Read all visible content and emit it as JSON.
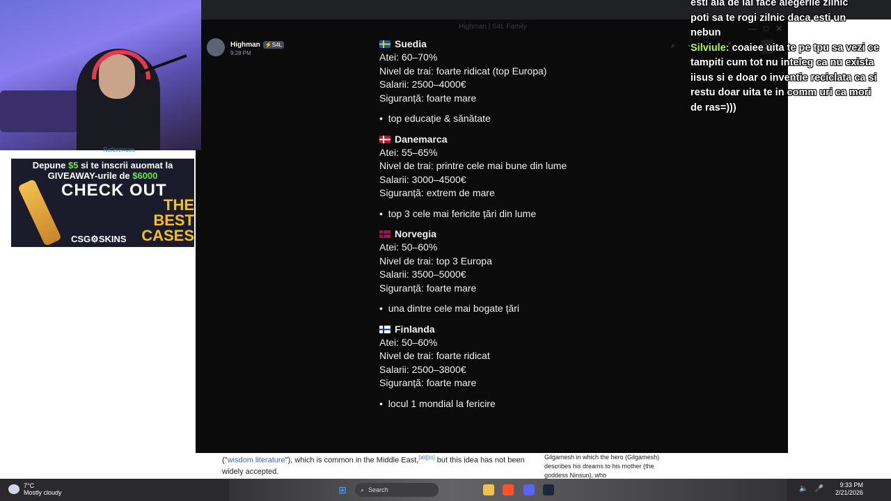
{
  "window_title": "Highman | S4L Family",
  "post": {
    "username": "Highman",
    "badge": "⚡S4L",
    "time": "9:28 PM"
  },
  "countries": [
    {
      "name": "Suedia",
      "flag_colors": [
        "#0a5bb4",
        "#f6cd00"
      ],
      "atei": "Atei: 60–70%",
      "nivel": "Nivel de trai: foarte ridicat (top Europa)",
      "salarii": "Salarii: 2500–4000€",
      "siguranta": "Siguranță: foarte mare",
      "note": "top educație & sănătate"
    },
    {
      "name": "Danemarca",
      "flag_colors": [
        "#c8102e",
        "#ffffff"
      ],
      "atei": "Atei: 55–65%",
      "nivel": "Nivel de trai: printre cele mai bune din lume",
      "salarii": "Salarii: 3000–4500€",
      "siguranta": "Siguranță: extrem de mare",
      "note": "top 3 cele mai fericite țări din lume"
    },
    {
      "name": "Norvegia",
      "flag_colors": [
        "#ba0c2f",
        "#00205b"
      ],
      "atei": "Atei: 50–60%",
      "nivel": "Nivel de trai: top 3 Europa",
      "salarii": "Salarii: 3500–5000€",
      "siguranta": "Siguranță: foarte mare",
      "note": "una dintre cele mai bogate țări"
    },
    {
      "name": "Finlanda",
      "flag_colors": [
        "#ffffff",
        "#003580"
      ],
      "atei": "Atei: 50–60%",
      "nivel": "Nivel de trai: foarte ridicat",
      "salarii": "Salarii: 2500–3800€",
      "siguranta": "Siguranță: foarte mare",
      "note": "locul 1 mondial la fericire"
    }
  ],
  "chat": {
    "prev_line1": "esti ala de iai face alegerile zilnic",
    "prev_line2": "poti sa te rogi zilnic daca esti un",
    "prev_line3": "nebun",
    "author": "Silviule:",
    "message": "coaiee uita te pe tpu sa vezi ce tampiti cum tot nu inteleg ca nu exista iisus si e doar o inventie reciclata ca si restu doar uita te in comm uri ca mori de ras=)))",
    "name_color": "#b7ff3c"
  },
  "ad": {
    "line1_a": "Depune ",
    "line1_amount": "$5",
    "line1_b": " si te inscrii auomat la",
    "line2_a": "GIVEAWAY-urile de ",
    "line2_amount": "$6000",
    "check": "CHECK   OUT",
    "best_1": "THE BEST",
    "best_2": "CASES",
    "brand": "CSG⚙SKINS"
  },
  "webcam_caption": "References",
  "wiki": {
    "text_a": "(\"",
    "link": "wisdom literature",
    "text_b": "\"), which is common in the Middle East,",
    "sup": "[30][31]",
    "text_c": " but this idea has not been widely accepted.",
    "side": "Gilgamesh in which the hero (Gilgamesh) describes his dreams to his mother (the goddess Ninsun), who"
  },
  "taskbar": {
    "temp": "7°C",
    "weather": "Mostly cloudy",
    "search": "Search",
    "time": "9:33 PM",
    "date": "2/21/2026"
  }
}
